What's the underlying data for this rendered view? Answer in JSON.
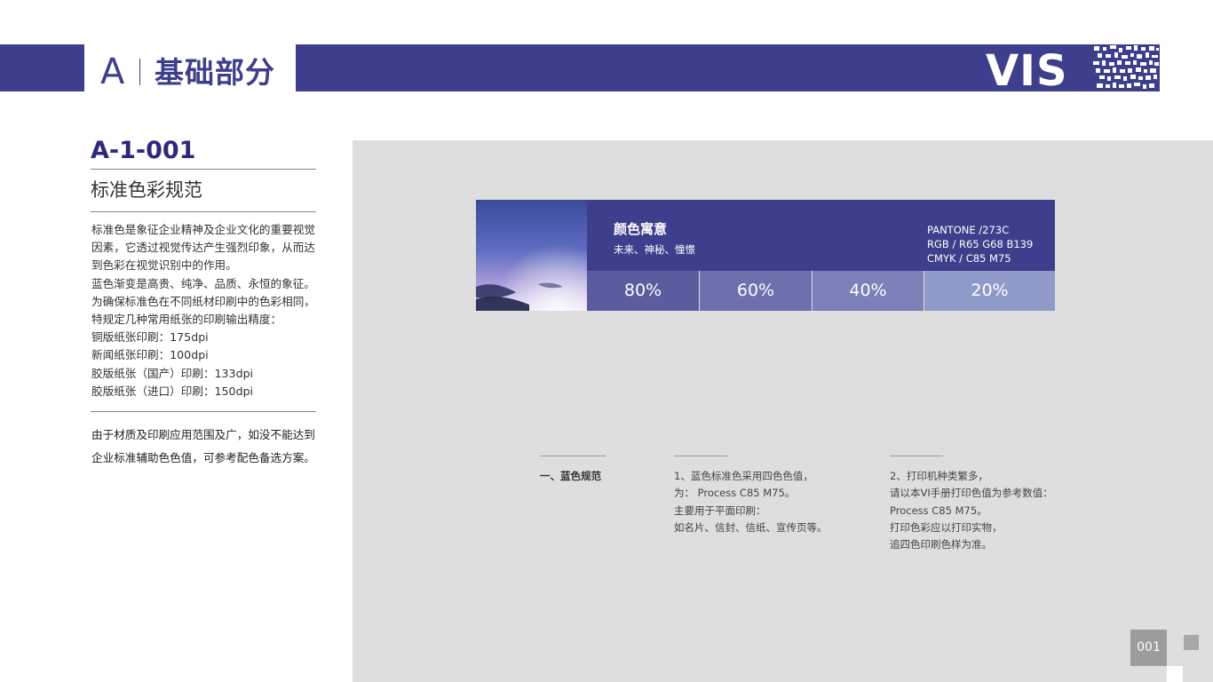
{
  "header": {
    "section_letter": "A",
    "section_title": "基础部分",
    "logo_text": "VIS",
    "brand_color": "#3e3f8c"
  },
  "left_panel": {
    "code": "A-1-001",
    "title": "标准色彩规范",
    "body_lines": [
      "标准色是象征企业精神及企业文化的重要视觉",
      "因素，它透过视觉传达产生强烈印象，从而达",
      "到色彩在视觉识别中的作用。",
      "蓝色渐变是高贵、纯净、品质、永恒的象征。",
      "为确保标准色在不同纸材印刷中的色彩相同，",
      "特规定几种常用纸张的印刷输出精度：",
      "铜版纸张印刷：175dpi",
      "新闻纸张印刷：100dpi",
      "胶版纸张（国产）印刷：133dpi",
      "胶版纸张（进口）印刷：150dpi"
    ],
    "note_lines": [
      "由于材质及印刷应用范围及广，如没不能达到",
      "企业标准辅助色色值，可参考配色备选方案。"
    ]
  },
  "color_card": {
    "title": "颜色寓意",
    "subtitle": "未来、神秘、憧憬",
    "codes": [
      "PANTONE /273C",
      "RGB / R65  G68  B139",
      "CMYK / C85  M75"
    ],
    "tints": [
      {
        "label": "80%",
        "color": "#5a5c9e"
      },
      {
        "label": "60%",
        "color": "#6d70ac"
      },
      {
        "label": "40%",
        "color": "#7c80b8"
      },
      {
        "label": "20%",
        "color": "#8e9bc8"
      }
    ]
  },
  "spec": {
    "heading": "一、蓝色规范",
    "col1": [
      "1、蓝色标准色采用四色色值，",
      "为：  Process  C85  M75。",
      "主要用于平面印刷：",
      "如名片、信封、信纸、宣传页等。"
    ],
    "col2": [
      "2、打印机种类繁多，",
      "请以本VI手册打印色值为参考数值：",
      "Process  C85  M75。",
      "打印色彩应以打印实物，",
      "追四色印刷色样为准。"
    ]
  },
  "footer": {
    "page_number": "001"
  }
}
